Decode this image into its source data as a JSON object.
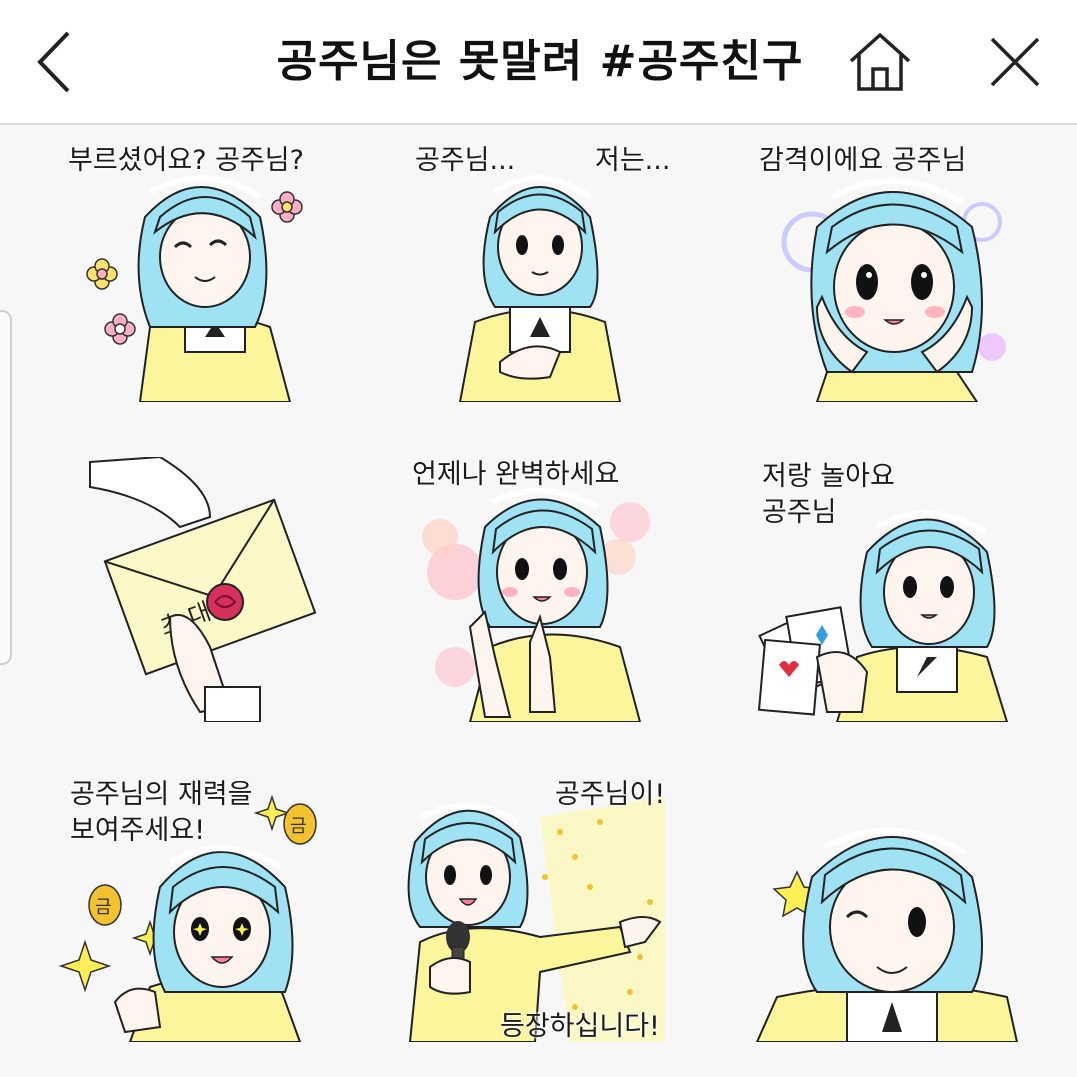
{
  "header": {
    "title": "공주님은 못말려 #공주친구"
  },
  "colors": {
    "hair": "#9fe2f3",
    "hair_dark": "#7cd0e6",
    "dress": "#fbf59c",
    "skin": "#fff5ee",
    "blush": "#ffb3c1",
    "outline": "#222222"
  },
  "stickers": [
    {
      "caption": "부르셨어요? 공주님?"
    },
    {
      "caption": "공주님...",
      "caption2": "저는..."
    },
    {
      "caption": "감격이에요 공주님"
    },
    {
      "caption": "",
      "envelope_text": "초 대 장"
    },
    {
      "caption": "언제나 완벽하세요"
    },
    {
      "caption": "저랑 놀아요\n공주님"
    },
    {
      "caption": "공주님의 재력을\n보여주세요!",
      "coin_text": "금"
    },
    {
      "caption": "공주님이!",
      "caption2": "등장하십니다!"
    },
    {
      "caption": ""
    }
  ]
}
